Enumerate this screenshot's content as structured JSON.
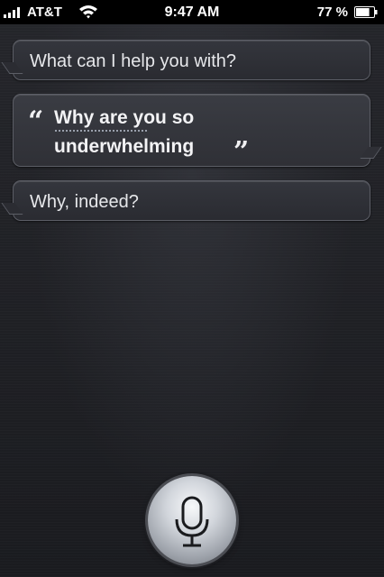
{
  "status_bar": {
    "carrier": "AT&T",
    "time": "9:47 AM",
    "battery_percent": "77 %",
    "battery_level": 0.77,
    "signal_bars": 4,
    "icons": [
      "signal-icon",
      "wifi-icon",
      "battery-icon"
    ]
  },
  "conversation": {
    "prompt": "What can I help you with?",
    "user_utterance_line1": "Why are you so",
    "user_utterance_line2": "underwhelming",
    "open_quote": "“",
    "close_quote": "”",
    "reply": "Why, indeed?"
  },
  "mic_button": {
    "icon": "microphone-icon"
  },
  "colors": {
    "background": "#1d1e22",
    "bubble_border": "#5c5e66",
    "text": "#e6e7ea"
  }
}
